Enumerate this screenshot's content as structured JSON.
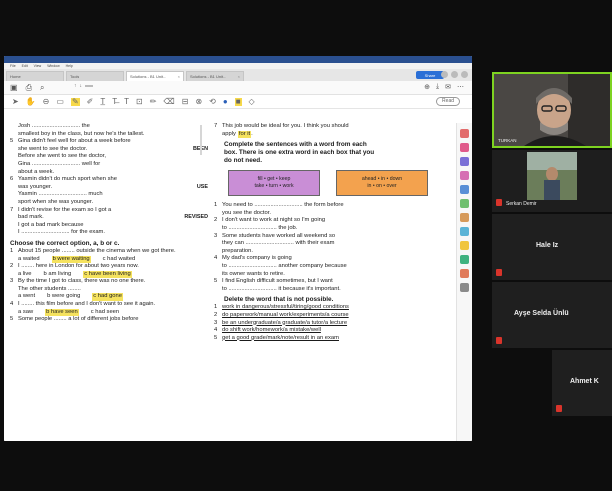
{
  "pdf": {
    "title_bar": "",
    "menu": [
      "File",
      "Edit",
      "View",
      "Window",
      "Help"
    ],
    "tabs": [
      {
        "label": "Home"
      },
      {
        "label": "Tools"
      },
      {
        "label": "Solutions - B1 Unit..."
      },
      {
        "label": "Solutions - B1 Unit..."
      }
    ],
    "share_label": "Share",
    "page_current": "",
    "page_total": "",
    "read_aloud": "Read"
  },
  "document": {
    "left": [
      {
        "type": "line",
        "text": "Josh .............................. the"
      },
      {
        "type": "line",
        "text": "smallest boy in the class, but now he's the tallest."
      },
      {
        "type": "row",
        "num": "5",
        "text": "Gina didn't feel well for about a week before",
        "right": ""
      },
      {
        "type": "line",
        "text": "she went to see the doctor.",
        "right": "BEEN"
      },
      {
        "type": "line",
        "text": "Before she went to see the doctor,"
      },
      {
        "type": "line",
        "text": "Gina .............................. well for"
      },
      {
        "type": "line",
        "text": "about a week."
      },
      {
        "type": "row",
        "num": "6",
        "text": "Yasmin didn't do much sport when she"
      },
      {
        "type": "line",
        "text": "was younger.",
        "right": "USE"
      },
      {
        "type": "line",
        "text": "Yasmin .............................. much"
      },
      {
        "type": "line",
        "text": "sport when she was younger."
      },
      {
        "type": "row",
        "num": "7",
        "text": "I didn't revise for the exam so I got a"
      },
      {
        "type": "line",
        "text": "bad mark.",
        "right": "REVISED"
      },
      {
        "type": "line",
        "text": "I got a bad mark because"
      },
      {
        "type": "line",
        "text": "I .............................. for the exam."
      }
    ],
    "left_section_title": "Choose the correct option, a, b or c.",
    "left_items": [
      {
        "num": "1",
        "text": "About 15 people ........ outside the cinema when we got there."
      },
      {
        "opts": [
          {
            "t": "a  waited"
          },
          {
            "t": "b  were waiting",
            "hl": true
          },
          {
            "t": "c  had waited"
          }
        ]
      },
      {
        "num": "2",
        "text": "I ........ here in London for about two years now."
      },
      {
        "opts": [
          {
            "t": "a  live"
          },
          {
            "t": "b  am living"
          },
          {
            "t": "c  have been living",
            "hl": true
          }
        ]
      },
      {
        "num": "3",
        "text": "By the time I got to class, there was no one there."
      },
      {
        "text": "The other students ........"
      },
      {
        "opts": [
          {
            "t": "a  went"
          },
          {
            "t": "b  were going"
          },
          {
            "t": "c  had gone",
            "hl": true
          }
        ]
      },
      {
        "num": "4",
        "text": "I ........ this film before and I don't want to see it again."
      },
      {
        "opts": [
          {
            "t": "a  saw"
          },
          {
            "t": "b  have seen",
            "hl": true
          },
          {
            "t": "c  had seen"
          }
        ]
      },
      {
        "num": "5",
        "text": "Some people ........ a lot of different jobs before"
      }
    ],
    "right_top": [
      {
        "num": "7",
        "text": "This job would be ideal for you. I think you should"
      },
      {
        "text": "apply",
        "hl": "for it",
        "tail": "."
      }
    ],
    "right_section2_title": [
      "Complete the sentences with a word from each",
      "box. There is one extra word in each box that you",
      "do not need."
    ],
    "box_purple": [
      "fill • get • keep",
      "take • turn • work"
    ],
    "box_orange": [
      "ahead • in • down",
      "in • on • over"
    ],
    "right_items2": [
      {
        "num": "1",
        "text": "You need to .............................. the form before"
      },
      {
        "text": "you see the doctor."
      },
      {
        "num": "2",
        "text": "I don't want to work at night so I'm going"
      },
      {
        "text": "to .............................. the job."
      },
      {
        "num": "3",
        "text": "Some students have worked all weekend so"
      },
      {
        "text": "they can .............................. with their exam"
      },
      {
        "text": "preparation."
      },
      {
        "num": "4",
        "text": "My dad's company is going"
      },
      {
        "text": "to .............................. another company because"
      },
      {
        "text": "its owner wants to retire."
      },
      {
        "num": "5",
        "text": "I find English difficult sometimes, but I want"
      },
      {
        "text": "to .............................. it because it's important."
      }
    ],
    "right_section3_title": "Delete the word that is not possible.",
    "right_items3": [
      {
        "num": "1",
        "text": "work in dangerous/stressful/tiring/good conditions"
      },
      {
        "num": "2",
        "text": "do paperwork/manual work/experiments/a course"
      },
      {
        "num": "3",
        "text": "be an undergraduate/a graduate/a tutor/a lecture"
      },
      {
        "num": "4",
        "text": "do shift work/homework/a mistake/well"
      },
      {
        "num": "5",
        "text": "get a good grade/mark/note/result in an exam"
      }
    ]
  },
  "participants": [
    {
      "name": "TURKAN",
      "speaking": true
    },
    {
      "name": "Serkan Demir"
    },
    {
      "name": "Hale Iz"
    },
    {
      "name": "Ayşe Selda Ünlü"
    },
    {
      "name": "Ahmet K"
    }
  ],
  "colors": {
    "speaking_border": "#7ed321",
    "muted_mic": "#d9342b",
    "highlight": "#f5e25e",
    "purple_box": "#c98ed6",
    "orange_box": "#f3a24e"
  }
}
